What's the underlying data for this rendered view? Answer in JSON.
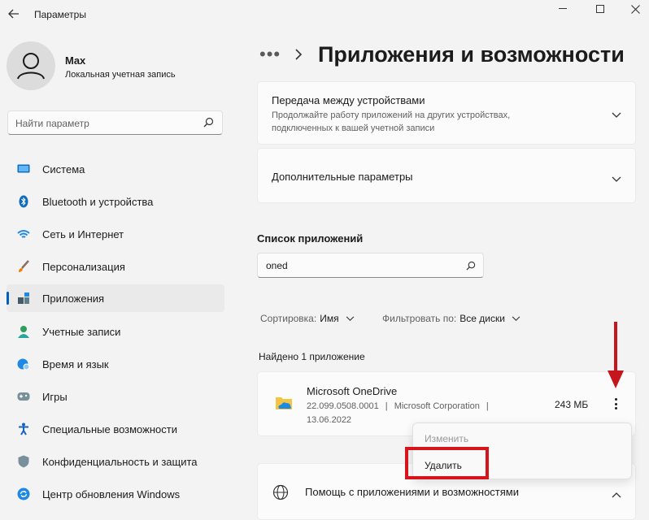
{
  "window": {
    "title": "Параметры"
  },
  "user": {
    "name": "Max",
    "account_type": "Локальная учетная запись"
  },
  "search": {
    "placeholder": "Найти параметр"
  },
  "sidebar": {
    "items": [
      {
        "label": "Система",
        "icon": "system-icon"
      },
      {
        "label": "Bluetooth и устройства",
        "icon": "bluetooth-icon"
      },
      {
        "label": "Сеть и Интернет",
        "icon": "wifi-icon"
      },
      {
        "label": "Персонализация",
        "icon": "brush-icon"
      },
      {
        "label": "Приложения",
        "icon": "apps-icon",
        "selected": true
      },
      {
        "label": "Учетные записи",
        "icon": "accounts-icon"
      },
      {
        "label": "Время и язык",
        "icon": "globe-clock-icon"
      },
      {
        "label": "Игры",
        "icon": "gamepad-icon"
      },
      {
        "label": "Специальные возможности",
        "icon": "accessibility-icon"
      },
      {
        "label": "Конфиденциальность и защита",
        "icon": "shield-icon"
      },
      {
        "label": "Центр обновления Windows",
        "icon": "update-icon"
      }
    ]
  },
  "header": {
    "breadcrumb_dots": "•••",
    "title": "Приложения и возможности"
  },
  "cards": {
    "share": {
      "title": "Передача между устройствами",
      "desc_line1": "Продолжайте работу приложений на других устройствах,",
      "desc_line2": "подключенных к вашей учетной записи"
    },
    "advanced": {
      "title": "Дополнительные параметры"
    }
  },
  "app_list": {
    "title": "Список приложений",
    "search_value": "oned",
    "sort_label": "Сортировка:",
    "sort_value": "Имя",
    "filter_label": "Фильтровать по:",
    "filter_value": "Все диски",
    "found_text": "Найдено 1 приложение",
    "apps": [
      {
        "name": "Microsoft OneDrive",
        "version": "22.099.0508.0001",
        "publisher": "Microsoft Corporation",
        "date": "13.06.2022",
        "size": "243 МБ"
      }
    ]
  },
  "context_menu": {
    "modify": "Изменить",
    "uninstall": "Удалить"
  },
  "help_card": {
    "title": "Помощь с приложениями и возможностями"
  },
  "colors": {
    "accent": "#005fb8",
    "annotation_red": "#d7141c",
    "background": "#f3f3f3",
    "card": "#fbfbfb"
  }
}
